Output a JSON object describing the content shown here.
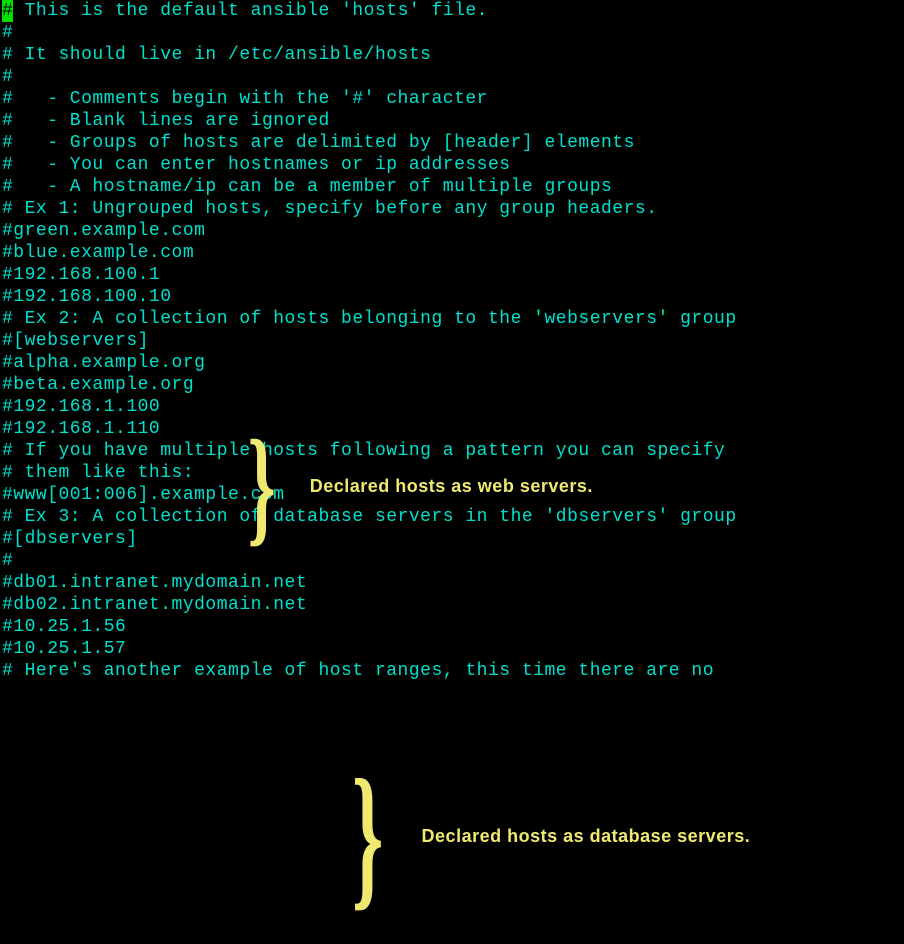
{
  "cursor_char": "#",
  "lines": [
    " This is the default ansible 'hosts' file.",
    "#",
    "# It should live in /etc/ansible/hosts",
    "#",
    "#   - Comments begin with the '#' character",
    "#   - Blank lines are ignored",
    "#   - Groups of hosts are delimited by [header] elements",
    "#   - You can enter hostnames or ip addresses",
    "#   - A hostname/ip can be a member of multiple groups",
    "",
    "# Ex 1: Ungrouped hosts, specify before any group headers.",
    "",
    "#green.example.com",
    "#blue.example.com",
    "#192.168.100.1",
    "#192.168.100.10",
    "",
    "# Ex 2: A collection of hosts belonging to the 'webservers' group",
    "",
    "#[webservers]",
    "#alpha.example.org",
    "#beta.example.org",
    "#192.168.1.100",
    "#192.168.1.110",
    "",
    "# If you have multiple hosts following a pattern you can specify",
    "# them like this:",
    "",
    "#www[001:006].example.com",
    "",
    "# Ex 3: A collection of database servers in the 'dbservers' group",
    "",
    "#[dbservers]",
    "#",
    "#db01.intranet.mydomain.net",
    "#db02.intranet.mydomain.net",
    "#10.25.1.56",
    "#10.25.1.57",
    "",
    "# Here's another example of host ranges, this time there are no"
  ],
  "annotations": {
    "webservers_label": "Declared hosts as web servers.",
    "dbservers_label": "Declared hosts as database servers."
  }
}
